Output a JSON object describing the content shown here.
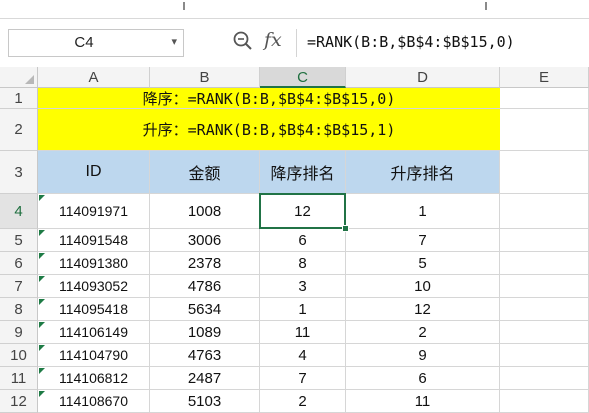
{
  "formula_bar": {
    "name_box": "C4",
    "fx_label": "fx",
    "formula": "=RANK(B:B,$B$4:$B$15,0)"
  },
  "columns": [
    "A",
    "B",
    "C",
    "D",
    "E"
  ],
  "selected_column": "C",
  "rows": [
    "1",
    "2",
    "3",
    "4",
    "5",
    "6",
    "7",
    "8",
    "9",
    "10",
    "11",
    "12"
  ],
  "selected_row": "4",
  "notes": {
    "desc": "降序：=RANK(B:B,$B$4:$B$15,0)",
    "asc": "升序：=RANK(B:B,$B$4:$B$15,1)"
  },
  "table_headers": [
    "ID",
    "金额",
    "降序排名",
    "升序排名"
  ],
  "table_rows": [
    [
      "114091971",
      "1008",
      "12",
      "1"
    ],
    [
      "114091548",
      "3006",
      "6",
      "7"
    ],
    [
      "114091380",
      "2378",
      "8",
      "5"
    ],
    [
      "114093052",
      "4786",
      "3",
      "10"
    ],
    [
      "114095418",
      "5634",
      "1",
      "12"
    ],
    [
      "114106149",
      "1089",
      "11",
      "2"
    ],
    [
      "114104790",
      "4763",
      "4",
      "9"
    ],
    [
      "114106812",
      "2487",
      "7",
      "6"
    ],
    [
      "114108670",
      "5103",
      "2",
      "11"
    ]
  ],
  "colors": {
    "highlight_yellow": "#ffff00",
    "header_blue": "#bdd7ee",
    "selection_green": "#217346"
  },
  "icons": {
    "zoom": "magnifier-icon",
    "dropdown": "chevron-down-icon"
  }
}
